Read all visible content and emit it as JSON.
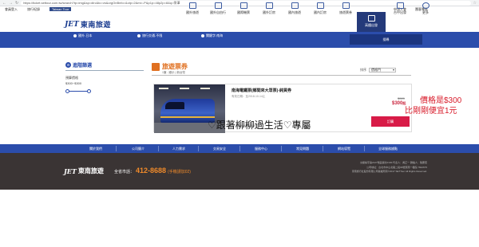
{
  "browser": {
    "url": "https://ticket.settour.com.tw/search?tp=img&sp=dirc&tc=vs&orgOnBnfo=&ctp=2&mi=-P&p1p=48p2p=8&q=季澤"
  },
  "toplinks": {
    "login": "會員登入",
    "history": "旅行紀錄",
    "taiwan_tour": "Taiwan Tour",
    "apply": "申請入會",
    "corp": "團客專區"
  },
  "brand": {
    "jet": "JET",
    "name": "東南旅遊"
  },
  "nav": {
    "items": [
      {
        "label": "國外旅遊"
      },
      {
        "label": "國外自由行"
      },
      {
        "label": "國際機票"
      },
      {
        "label": "國外訂房"
      },
      {
        "label": "國內旅遊"
      },
      {
        "label": "國內訂房"
      },
      {
        "label": "旅遊票券"
      },
      {
        "label": "高鐵出發"
      },
      {
        "label": "台中出發"
      },
      {
        "label": "更多"
      }
    ]
  },
  "search_band": {
    "opt1": "國外-日本",
    "opt2": "旅行交通-不限",
    "opt3": "關鍵字:南海",
    "button": "搜尋"
  },
  "filter": {
    "title": "進階篩選",
    "price_label": "預算價格",
    "price_range": "$300~$300",
    "slider_min": "$300~$300"
  },
  "results": {
    "title": "旅遊票券",
    "subtitle": "1筆 - 顯示 | 新台幣",
    "sort_label": "排序",
    "sort_value": "價格門"
  },
  "product": {
    "name": "南海電鐵票(鄉間來大眾票)-純買券",
    "date": "有效日期：至2018-10-14止",
    "code": "TKT0000000000NK",
    "old_price": "$320",
    "new_price": "$300",
    "new_price_suffix": "起",
    "buy": "訂購"
  },
  "overlays": {
    "caption": "♡跟著柳柳過生活♡專屬",
    "price_note": "價格是$300",
    "cheaper_note": "比剛剛便宜1元"
  },
  "footer_nav": [
    {
      "label": "關於我們"
    },
    {
      "label": "公司簡介"
    },
    {
      "label": "人力需求"
    },
    {
      "label": "交易安全"
    },
    {
      "label": "服務中心"
    },
    {
      "label": "常見問題"
    },
    {
      "label": "網站導覽"
    },
    {
      "label": "全球服務據點"
    }
  ],
  "footer": {
    "hotline_label": "全省市話：",
    "hotline": "412-8688",
    "hotline_note": "(手機請加02)",
    "info_lines": [
      "交觀綜字第2127號品保北0130 代表人：黃正一 聯絡人：陳慶若",
      "公司地址：台北市中山北路二段96號東南一樓館 7822675",
      "東南旅行社股份有限公司版權所有©2017 SETTour All Rights Reserved."
    ]
  },
  "colors": {
    "brand_blue": "#2b4dab",
    "accent_orange": "#e07020",
    "price_red": "#c9233b",
    "buy_red": "#d81b47",
    "footer_dark": "#3a3434"
  }
}
